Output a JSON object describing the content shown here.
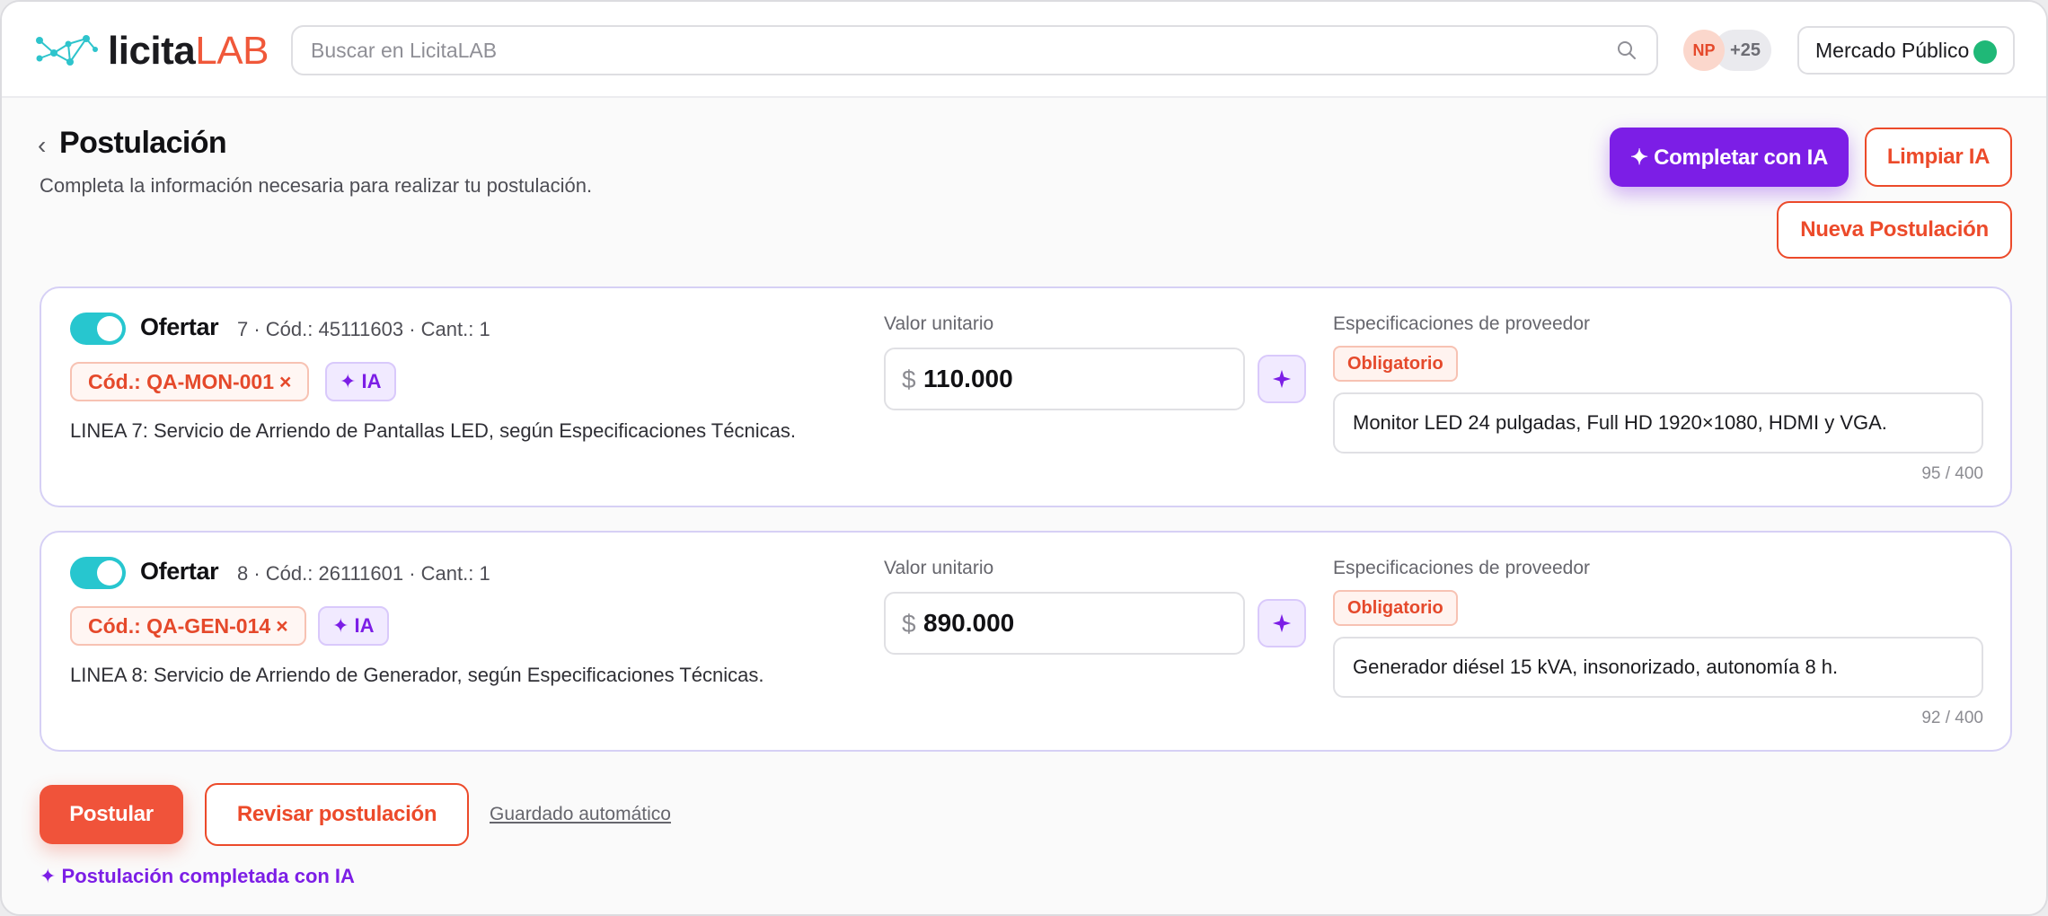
{
  "header": {
    "logo_part1": "licita",
    "logo_part2": "LAB",
    "search_placeholder": "Buscar en LicitaLAB",
    "avatar_initials": "NP",
    "avatar_more": "+25",
    "market_label": "Mercado Público",
    "market_status_color": "#1fb877"
  },
  "page": {
    "back_glyph": "‹",
    "title": "Postulación",
    "subtitle": "Completa la información necesaria para realizar tu postulación.",
    "btn_complete_ai": "✦ Completar con IA",
    "btn_clear_ai": "Limpiar IA",
    "btn_new": "Nueva Postulación"
  },
  "items": [
    {
      "toggle_on": true,
      "offer_label": "Ofertar",
      "meta": "7 · Cód.: 45111603 · Cant.: 1",
      "code_chip": "Cód.: QA-MON-001",
      "code_chip_remove": "×",
      "ia_chip": "✦ IA",
      "description": "LINEA 7: Servicio de Arriendo de Pantallas LED, según Especificaciones Técnicas.",
      "price_label": "Valor unitario",
      "currency": "$",
      "price": "110.000",
      "spec_label": "Especificaciones de proveedor",
      "required_badge": "Obligatorio",
      "spec": "Monitor LED 24 pulgadas, Full HD 1920×1080, HDMI y VGA.",
      "counter": "95 / 400"
    },
    {
      "toggle_on": true,
      "offer_label": "Ofertar",
      "meta": "8 · Cód.: 26111601 · Cant.: 1",
      "code_chip": "Cód.: QA-GEN-014",
      "code_chip_remove": "×",
      "ia_chip": "✦ IA",
      "description": "LINEA 8: Servicio de Arriendo de Generador, según Especificaciones Técnicas.",
      "price_label": "Valor unitario",
      "currency": "$",
      "price": "890.000",
      "spec_label": "Especificaciones de proveedor",
      "required_badge": "Obligatorio",
      "spec": "Generador diésel 15 kVA, insonorizado, autonomía 8 h.",
      "counter": "92 / 400"
    }
  ],
  "footer": {
    "btn_submit": "Postular",
    "btn_review": "Revisar postulación",
    "autosave": "Guardado automático",
    "ai_status": "✦ Postulación completada con IA"
  },
  "colors": {
    "accent_orange": "#f0533a",
    "accent_purple": "#7c1ee6",
    "toggle_teal": "#27c6cf"
  }
}
